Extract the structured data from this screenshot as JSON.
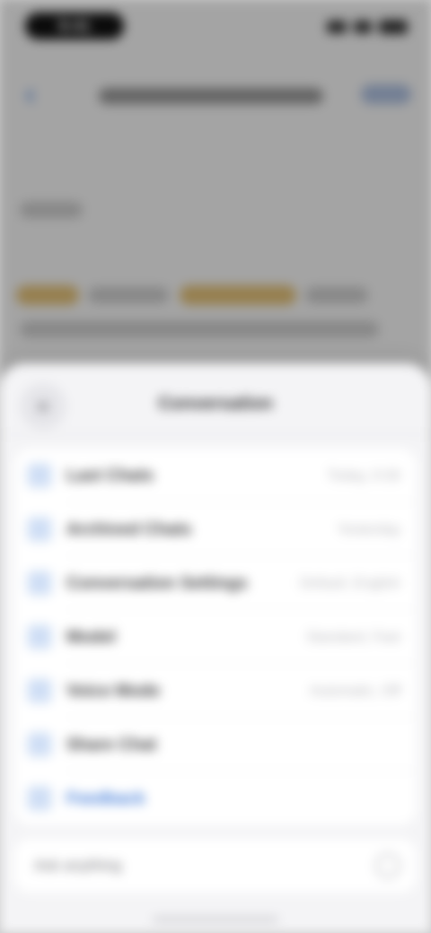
{
  "status": {
    "time": "9:41"
  },
  "nav": {
    "back_glyph": "‹"
  },
  "sheet": {
    "close_glyph": "×",
    "title": "Conversation"
  },
  "rows": [
    {
      "icon": "chat-icon",
      "glyph": "◦",
      "label": "Last Chats",
      "value": "Today, 9:30"
    },
    {
      "icon": "archive-icon",
      "glyph": "◦",
      "label": "Archived Chats",
      "value": "Yesterday"
    },
    {
      "icon": "settings-icon",
      "glyph": "◦",
      "label": "Conversation Settings",
      "value": "Default, English"
    },
    {
      "icon": "model-icon",
      "glyph": "◦",
      "label": "Model",
      "value": "Standard, Fast"
    },
    {
      "icon": "voice-icon",
      "glyph": "◦",
      "label": "Voice Mode",
      "value": "Automatic, Off"
    },
    {
      "icon": "share-icon",
      "glyph": "◦",
      "label": "Share Chat",
      "value": ""
    },
    {
      "icon": "feedback-icon",
      "glyph": "◦",
      "label": "Feedback",
      "value": ""
    }
  ],
  "input": {
    "placeholder": "Ask anything",
    "send_glyph": "↑"
  }
}
